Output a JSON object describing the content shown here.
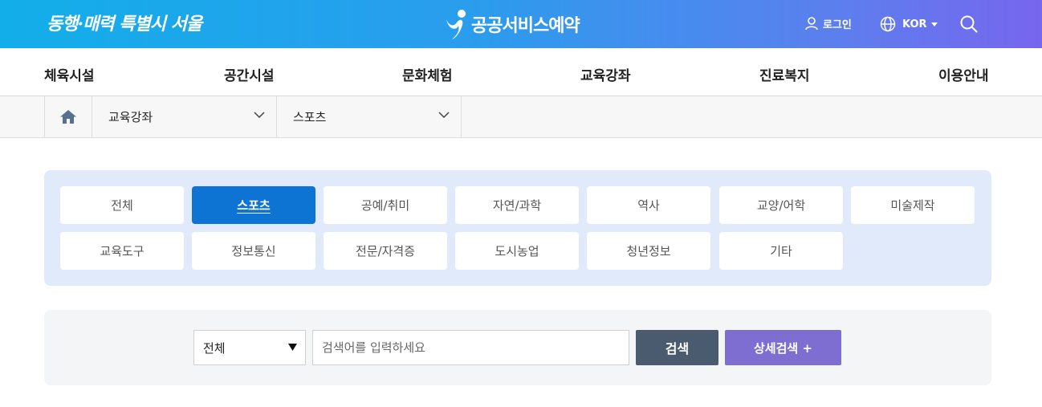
{
  "header": {
    "slogan": "동행·매력 특별시 서울",
    "brand": "공공서비스예약",
    "login": "로그인",
    "language": "KOR"
  },
  "nav": [
    "체육시설",
    "공간시설",
    "문화체험",
    "교육강좌",
    "진료복지",
    "이용안내"
  ],
  "breadcrumb": {
    "level1": "교육강좌",
    "level2": "스포츠"
  },
  "categories": [
    {
      "label": "전체",
      "active": false
    },
    {
      "label": "스포츠",
      "active": true
    },
    {
      "label": "공예/취미",
      "active": false
    },
    {
      "label": "자연/과학",
      "active": false
    },
    {
      "label": "역사",
      "active": false
    },
    {
      "label": "교양/어학",
      "active": false
    },
    {
      "label": "미술제작",
      "active": false
    },
    {
      "label": "교육도구",
      "active": false
    },
    {
      "label": "정보통신",
      "active": false
    },
    {
      "label": "전문/자격증",
      "active": false
    },
    {
      "label": "도시농업",
      "active": false
    },
    {
      "label": "청년정보",
      "active": false
    },
    {
      "label": "기타",
      "active": false
    }
  ],
  "search": {
    "scope_selected": "전체",
    "placeholder": "검색어를 입력하세요",
    "value": "",
    "search_label": "검색",
    "detail_label": "상세검색 +"
  },
  "colors": {
    "header_gradient_start": "#12aee9",
    "header_gradient_end": "#7766ee",
    "active_category": "#0e74d3",
    "category_panel": "#e0eafa",
    "search_button": "#4a5a6f",
    "detail_button": "#7f6ed1"
  }
}
